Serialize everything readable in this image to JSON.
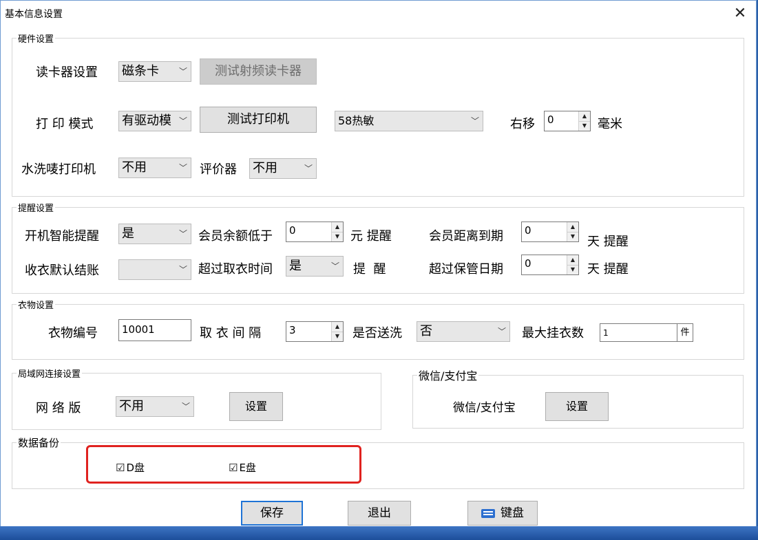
{
  "window": {
    "title": "基本信息设置",
    "close_label": "✕"
  },
  "hardware": {
    "legend": "硬件设置",
    "card_reader_label": "读卡器设置",
    "card_reader_value": "磁条卡",
    "test_rf_button": "测试射频读卡器",
    "print_mode_label": "打 印 模式",
    "print_mode_value": "有驱动模",
    "test_printer_button": "测试打印机",
    "printer_type_value": "58热敏",
    "shift_label": "右移",
    "shift_value": "0",
    "shift_unit": "毫米",
    "wash_label_printer_label": "水洗唛打印机",
    "wash_label_printer_value": "不用",
    "evaluator_label": "评价器",
    "evaluator_value": "不用"
  },
  "reminder": {
    "legend": "提醒设置",
    "startup_label": "开机智能提醒",
    "startup_value": "是",
    "balance_label": "会员余额低于",
    "balance_value": "0",
    "balance_unit": "元 提醒",
    "expiry_label": "会员距离到期",
    "expiry_value": "0",
    "expiry_unit": "天 提醒",
    "checkout_label": "收衣默认结账",
    "checkout_value": "",
    "overdue_pickup_label": "超过取衣时间",
    "overdue_pickup_value": "是",
    "overdue_pickup_unit": "提  醒",
    "overdue_storage_label": "超过保管日期",
    "overdue_storage_value": "0",
    "overdue_storage_unit": "天 提醒"
  },
  "clothes": {
    "legend": "衣物设置",
    "number_label": "衣物编号",
    "number_value": "10001",
    "interval_label": "取 衣 间 隔",
    "interval_value": "3",
    "send_wash_label": "是否送洗",
    "send_wash_value": "否",
    "max_hang_label": "最大挂衣数",
    "max_hang_value": "1",
    "max_hang_unit": "件"
  },
  "lan": {
    "legend": "局域网连接设置",
    "network_label": "网 络 版",
    "network_value": "不用",
    "settings_button": "设置"
  },
  "payment": {
    "legend": "微信/支付宝",
    "label": "微信/支付宝",
    "settings_button": "设置"
  },
  "backup": {
    "legend": "数据备份",
    "d_drive": {
      "label": "D盘",
      "checked": true
    },
    "e_drive": {
      "label": "E盘",
      "checked": true
    },
    "check_mark": "☑"
  },
  "footer": {
    "save_button": "保存",
    "exit_button": "退出",
    "keyboard_button": "键盘"
  },
  "colors": {
    "highlight": "#e0221f",
    "accent": "#2b6ecf"
  }
}
